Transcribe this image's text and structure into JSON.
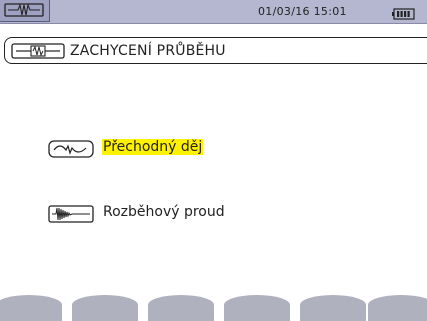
{
  "status_bar": {
    "mode_icon": "waveform-capture-icon",
    "datetime": "01/03/16  15:01",
    "battery_icon": "battery-full-icon"
  },
  "title_bar": {
    "icon": "waveform-capture-icon",
    "title": "ZACHYCENÍ PRŮBĚHU"
  },
  "menu": {
    "items": [
      {
        "icon": "transient-icon",
        "label": "Přechodný děj",
        "selected": true
      },
      {
        "icon": "inrush-current-icon",
        "label": "Rozběhový proud",
        "selected": false
      }
    ]
  },
  "function_keys": [
    "",
    "",
    "",
    "",
    "",
    ""
  ],
  "colors": {
    "highlight": "#fff200",
    "status_bar": "#b5b6cf",
    "function_key": "#b0b1bf"
  }
}
